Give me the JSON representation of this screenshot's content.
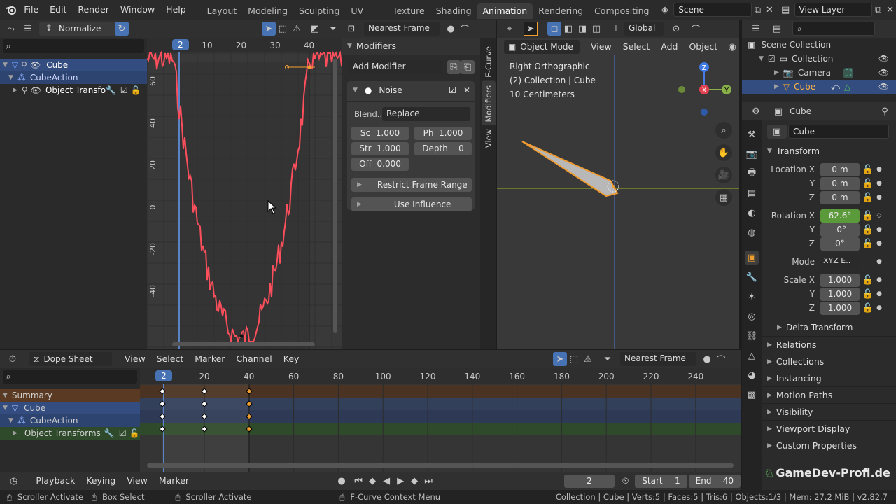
{
  "menu": [
    "File",
    "Edit",
    "Render",
    "Window",
    "Help"
  ],
  "workspaces": [
    {
      "label": "Layout",
      "active": false
    },
    {
      "label": "Modeling",
      "active": false
    },
    {
      "label": "Sculpting",
      "active": false
    },
    {
      "label": "UV Editing",
      "active": false
    },
    {
      "label": "Texture Paint",
      "active": false
    },
    {
      "label": "Shading",
      "active": false
    },
    {
      "label": "Animation",
      "active": true
    },
    {
      "label": "Rendering",
      "active": false
    },
    {
      "label": "Compositing",
      "active": false
    }
  ],
  "scene": {
    "name": "Scene",
    "view_layer": "View Layer"
  },
  "graph": {
    "normalize": "Normalize",
    "snap": "Nearest Frame",
    "frame_current": "2",
    "frame_ticks": [
      "10",
      "20",
      "30",
      "40"
    ],
    "value_ticks": [
      "60",
      "40",
      "20",
      "0",
      "-20",
      "-40"
    ],
    "channels": [
      {
        "label": "Cube",
        "level": 0
      },
      {
        "label": "CubeAction",
        "level": 1
      },
      {
        "label": "Object Transforms",
        "level": 2
      }
    ]
  },
  "modifiers": {
    "title": "Modifiers",
    "add_label": "Add Modifier",
    "noise_label": "Noise",
    "blend_label": "Blend..",
    "blend_value": "Replace",
    "fields": [
      {
        "label": "Sc",
        "value": "1.000"
      },
      {
        "label": "Ph",
        "value": "1.000"
      },
      {
        "label": "Str",
        "value": "1.000"
      },
      {
        "label": "Depth",
        "value": "0"
      },
      {
        "label": "Off",
        "value": "0.000"
      }
    ],
    "restrict": "Restrict Frame Range",
    "influence": "Use Influence",
    "side_tabs": [
      "F-Curve",
      "Modifiers",
      "View"
    ]
  },
  "viewport": {
    "mode": "Object Mode",
    "menus": [
      "View",
      "Select",
      "Add",
      "Object"
    ],
    "orientation": "Global",
    "info1": "Right Orthographic",
    "info2": "(2) Collection | Cube",
    "info3": "10 Centimeters",
    "axis_z": "Z",
    "axis_y": "Y",
    "axis_x": "X"
  },
  "outliner": {
    "items": [
      {
        "label": "Scene Collection",
        "level": 0,
        "selected": false
      },
      {
        "label": "Collection",
        "level": 1,
        "selected": false
      },
      {
        "label": "Camera",
        "level": 2,
        "selected": false
      },
      {
        "label": "Cube",
        "level": 2,
        "selected": true
      }
    ]
  },
  "properties": {
    "object_name": "Cube",
    "datablock": "Cube",
    "transform_title": "Transform",
    "location": {
      "label": "Location X",
      "x": "0 m",
      "y": "0 m",
      "z": "0 m"
    },
    "rotation": {
      "label": "Rotation X",
      "x": "62.6°",
      "y": "-0°",
      "z": "0°"
    },
    "mode_label": "Mode",
    "mode_value": "XYZ E..",
    "scale": {
      "label": "Scale X",
      "x": "1.000",
      "y": "1.000",
      "z": "1.000"
    },
    "y_label": "Y",
    "z_label": "Z",
    "delta": "Delta Transform",
    "sections": [
      "Relations",
      "Collections",
      "Instancing",
      "Motion Paths",
      "Visibility",
      "Viewport Display",
      "Custom Properties"
    ],
    "watermark": "GameDev-Profi.de"
  },
  "dopesheet": {
    "mode": "Dope Sheet",
    "menus": [
      "View",
      "Select",
      "Marker",
      "Channel",
      "Key"
    ],
    "snap": "Nearest Frame",
    "frame_current": "2",
    "ticks": [
      "20",
      "40",
      "60",
      "80",
      "100",
      "120",
      "140",
      "160",
      "180",
      "200",
      "220",
      "240"
    ],
    "channels": [
      {
        "label": "Summary",
        "kind": "summary"
      },
      {
        "label": "Cube",
        "kind": "object"
      },
      {
        "label": "CubeAction",
        "kind": "action"
      },
      {
        "label": "Object Transforms",
        "kind": "group"
      }
    ]
  },
  "timeline": {
    "menus": [
      "Playback",
      "Keying",
      "View",
      "Marker"
    ],
    "current": "2",
    "start_label": "Start",
    "start": "1",
    "end_label": "End",
    "end": "40"
  },
  "status": {
    "left1": "Scroller Activate",
    "left2": "Box Select",
    "left3": "Scroller Activate",
    "middle": "F-Curve Context Menu",
    "right": "Collection | Cube | Verts:5 | Faces:5 | Tris:6 | Objects:1/3 | Mem: 27.2 MiB | v2.82.7"
  },
  "colors": {
    "accent": "#4772b3",
    "selection": "#334d80",
    "keyframe": "#f0a030",
    "curve": "#e8404c"
  }
}
